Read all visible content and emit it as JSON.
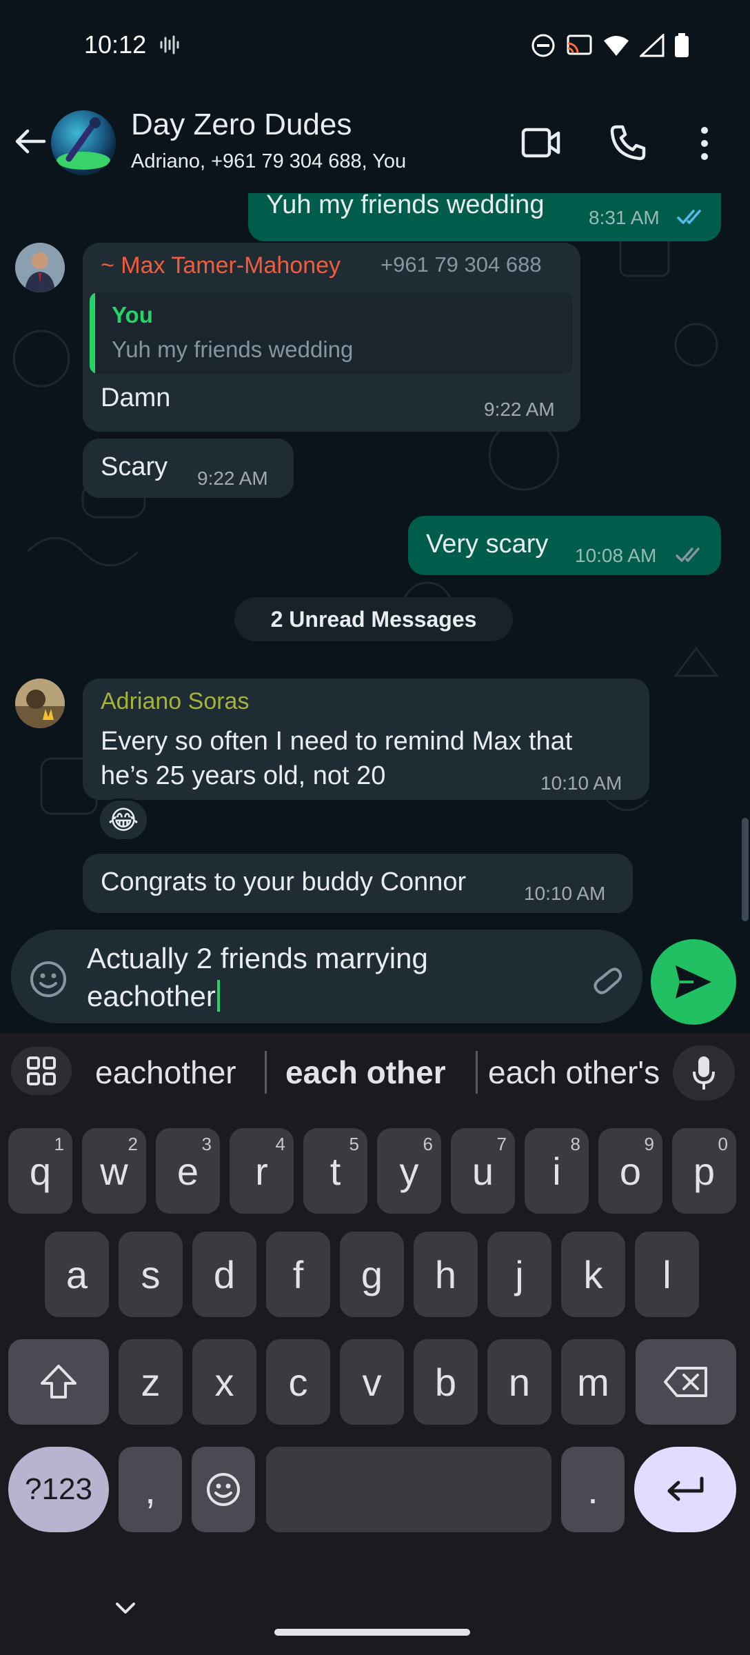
{
  "status_bar": {
    "time": "10:12"
  },
  "header": {
    "title": "Day Zero Dudes",
    "members": "Adriano, +961 79 304 688, You"
  },
  "messages": {
    "m0": {
      "text": "Yuh my friends wedding",
      "time": "8:31 AM"
    },
    "m1": {
      "sender": "~ Max Tamer-Mahoney",
      "sender_phone": "+961 79 304 688",
      "quote_author": "You",
      "quote_text": "Yuh my friends wedding",
      "text": "Damn",
      "time": "9:22 AM"
    },
    "m2": {
      "text": "Scary",
      "time": "9:22 AM"
    },
    "m3": {
      "text": "Very scary",
      "time": "10:08 AM"
    },
    "unread": "2 Unread Messages",
    "m4": {
      "sender": "Adriano Soras",
      "text_line1": "Every so often I need to remind Max that",
      "text_line2": "he’s 25 years old, not 20",
      "time": "10:10 AM",
      "reaction": "😂"
    },
    "m5": {
      "text": "Congrats to your buddy Connor",
      "time": "10:10 AM"
    }
  },
  "composer": {
    "line1": "Actually 2 friends marrying",
    "line2": "eachother"
  },
  "keyboard": {
    "suggestions": [
      "eachother",
      "each other",
      "each other's"
    ],
    "row1": [
      {
        "k": "q",
        "h": "1"
      },
      {
        "k": "w",
        "h": "2"
      },
      {
        "k": "e",
        "h": "3"
      },
      {
        "k": "r",
        "h": "4"
      },
      {
        "k": "t",
        "h": "5"
      },
      {
        "k": "y",
        "h": "6"
      },
      {
        "k": "u",
        "h": "7"
      },
      {
        "k": "i",
        "h": "8"
      },
      {
        "k": "o",
        "h": "9"
      },
      {
        "k": "p",
        "h": "0"
      }
    ],
    "row2": [
      "a",
      "s",
      "d",
      "f",
      "g",
      "h",
      "j",
      "k",
      "l"
    ],
    "row3": [
      "z",
      "x",
      "c",
      "v",
      "b",
      "n",
      "m"
    ],
    "symbols": "?123",
    "comma": ",",
    "period": "."
  },
  "colors": {
    "accent_green": "#21c063",
    "sender_max": "#f15c3c",
    "sender_adriano": "#a5b337",
    "quote_you": "#25d366",
    "read_tick": "#53bdeb"
  }
}
